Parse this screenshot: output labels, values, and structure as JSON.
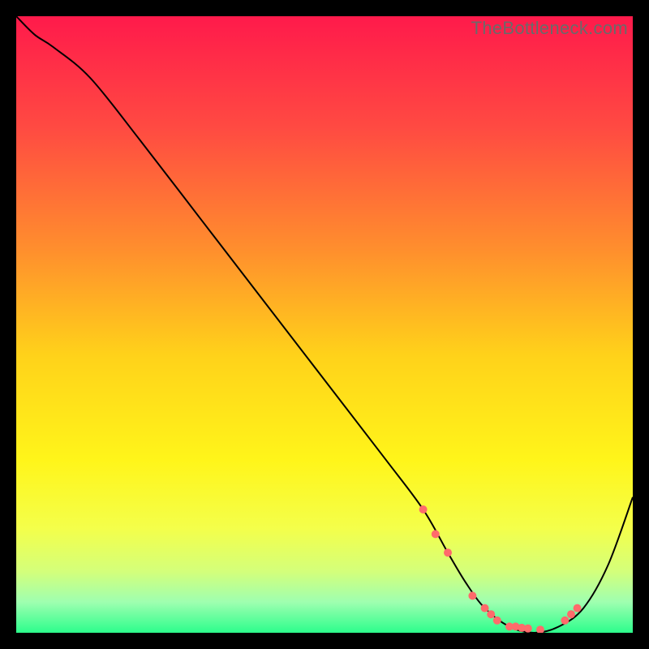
{
  "watermark": "TheBottleneck.com",
  "chart_data": {
    "type": "line",
    "title": "",
    "xlabel": "",
    "ylabel": "",
    "xlim": [
      0,
      100
    ],
    "ylim": [
      0,
      100
    ],
    "grid": false,
    "legend": false,
    "background_gradient": {
      "stops": [
        {
          "offset": 0.0,
          "color": "#ff1a4b"
        },
        {
          "offset": 0.18,
          "color": "#ff4a42"
        },
        {
          "offset": 0.38,
          "color": "#ff8f2d"
        },
        {
          "offset": 0.55,
          "color": "#ffd21a"
        },
        {
          "offset": 0.72,
          "color": "#fff51a"
        },
        {
          "offset": 0.83,
          "color": "#f4ff4a"
        },
        {
          "offset": 0.9,
          "color": "#d4ff7a"
        },
        {
          "offset": 0.95,
          "color": "#9fffb0"
        },
        {
          "offset": 1.0,
          "color": "#2cfd8c"
        }
      ]
    },
    "series": [
      {
        "name": "curve",
        "color": "#000000",
        "stroke_width": 2,
        "x": [
          0,
          3,
          6,
          12,
          20,
          30,
          40,
          50,
          60,
          66,
          70,
          73,
          76,
          80,
          84,
          88,
          92,
          96,
          100
        ],
        "y": [
          100,
          97,
          95,
          90,
          80,
          67,
          54,
          41,
          28,
          20,
          13,
          8,
          4,
          1,
          0,
          1,
          4,
          11,
          22
        ]
      }
    ],
    "markers": {
      "name": "highlight-points",
      "color": "#ff6b6b",
      "radius": 5,
      "x": [
        66,
        68,
        70,
        74,
        76,
        77,
        78,
        80,
        81,
        82,
        83,
        85,
        89,
        90,
        91
      ],
      "y": [
        20,
        16,
        13,
        6,
        4,
        3,
        2,
        1,
        1,
        0.8,
        0.7,
        0.5,
        2,
        3,
        4
      ]
    }
  }
}
